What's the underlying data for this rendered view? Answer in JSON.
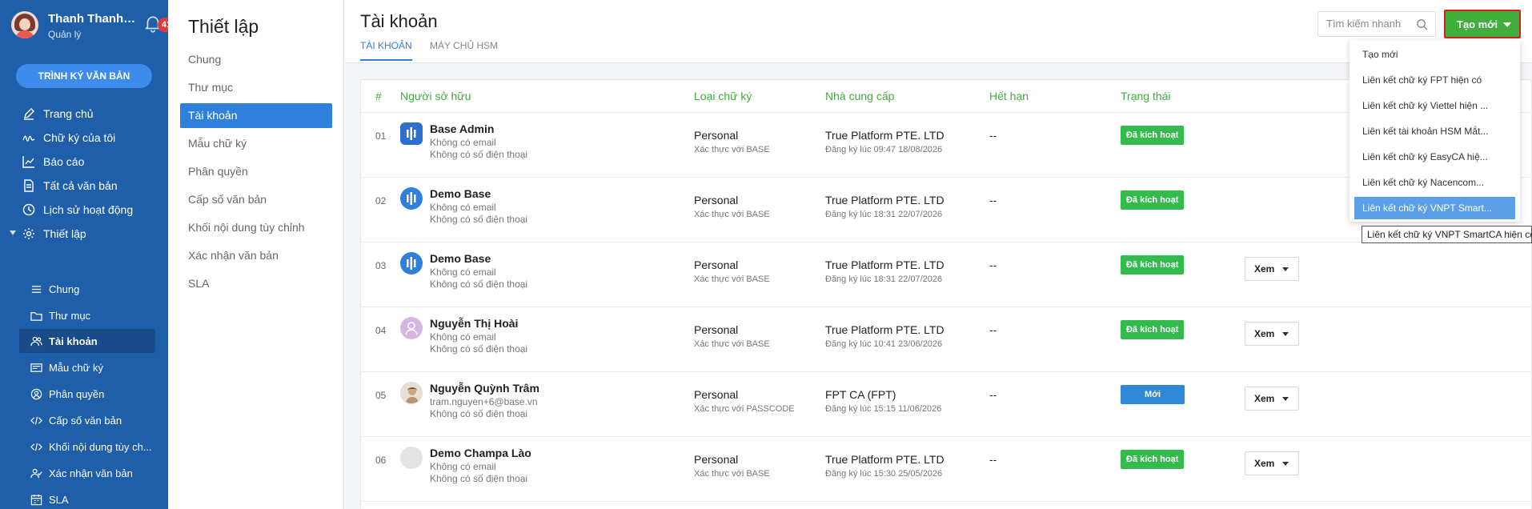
{
  "user": {
    "name": "Thanh Thanh ...",
    "role": "Quản lý",
    "notification_count": "41"
  },
  "sidebar": {
    "sign_button": "TRÌNH KÝ VĂN BẢN",
    "items": [
      {
        "label": "Trang chủ",
        "icon": "pen-icon"
      },
      {
        "label": "Chữ ký của tôi",
        "icon": "signature-icon"
      },
      {
        "label": "Báo cáo",
        "icon": "chart-icon"
      },
      {
        "label": "Tất cả văn bản",
        "icon": "document-icon"
      },
      {
        "label": "Lịch sử hoạt động",
        "icon": "clock-icon"
      },
      {
        "label": "Thiết lập",
        "icon": "gear-icon"
      }
    ],
    "sub_items": [
      {
        "label": "Chung",
        "icon": "list-icon"
      },
      {
        "label": "Thư mục",
        "icon": "folder-icon"
      },
      {
        "label": "Tài khoản",
        "icon": "users-icon"
      },
      {
        "label": "Mẫu chữ ký",
        "icon": "template-icon"
      },
      {
        "label": "Phân quyền",
        "icon": "user-circle-icon"
      },
      {
        "label": "Cấp số văn bản",
        "icon": "code-icon"
      },
      {
        "label": "Khối nội dung tùy ch...",
        "icon": "code-icon"
      },
      {
        "label": "Xác nhận văn bản",
        "icon": "user-check-icon"
      },
      {
        "label": "SLA",
        "icon": "calendar-icon"
      }
    ]
  },
  "settings": {
    "title": "Thiết lập",
    "items": [
      "Chung",
      "Thư mục",
      "Tài khoản",
      "Mẫu chữ ký",
      "Phân quyền",
      "Cấp số văn bản",
      "Khối nội dung tùy chỉnh",
      "Xác nhận văn bản",
      "SLA"
    ],
    "active": "Tài khoản"
  },
  "main": {
    "title": "Tài khoản",
    "tabs": [
      "TÀI KHOẢN",
      "MÁY CHỦ HSM"
    ],
    "search_placeholder": "Tìm kiếm nhanh",
    "create_label": "Tạo mới",
    "columns": [
      "#",
      "Người sở hữu",
      "Loại chữ ký",
      "Nhà cung cấp",
      "Hết hạn",
      "Trạng thái"
    ],
    "view_label": "Xem",
    "rows": [
      {
        "num": "01",
        "name": "Base Admin",
        "email": "Không có email",
        "phone": "Không có số điện thoại",
        "type": "Personal",
        "type_sub": "Xác thực với BASE",
        "provider": "True Platform PTE. LTD",
        "provider_sub": "Đăng ký lúc 09:47 18/08/2026",
        "expiry": "--",
        "status": "Đã kích hoạt",
        "avatar": "logo-hex"
      },
      {
        "num": "02",
        "name": "Demo Base",
        "email": "Không có email",
        "phone": "Không có số điện thoại",
        "type": "Personal",
        "type_sub": "Xác thực với BASE",
        "provider": "True Platform PTE. LTD",
        "provider_sub": "Đăng ký lúc 18:31 22/07/2026",
        "expiry": "--",
        "status": "Đã kích hoạt",
        "avatar": "logo"
      },
      {
        "num": "03",
        "name": "Demo Base",
        "email": "Không có email",
        "phone": "Không có số điện thoại",
        "type": "Personal",
        "type_sub": "Xác thực với BASE",
        "provider": "True Platform PTE. LTD",
        "provider_sub": "Đăng ký lúc 18:31 22/07/2026",
        "expiry": "--",
        "status": "Đã kích hoạt",
        "avatar": "logo"
      },
      {
        "num": "04",
        "name": "Nguyễn Thị Hoài",
        "email": "Không có email",
        "phone": "Không có số điện thoại",
        "type": "Personal",
        "type_sub": "Xác thực với BASE",
        "provider": "True Platform PTE. LTD",
        "provider_sub": "Đăng ký lúc 10:41 23/06/2026",
        "expiry": "--",
        "status": "Đã kích hoạt",
        "avatar": "person"
      },
      {
        "num": "05",
        "name": "Nguyễn Quỳnh Trâm",
        "email": "tram.nguyen+6@base.vn",
        "phone": "Không có số điện thoại",
        "type": "Personal",
        "type_sub": "Xác thực với PASSCODE",
        "provider": "FPT CA (FPT)",
        "provider_sub": "Đăng ký lúc 15:15 11/06/2026",
        "expiry": "--",
        "status": "Mới",
        "avatar": "photo"
      },
      {
        "num": "06",
        "name": "Demo Champa Lào",
        "email": "Không có email",
        "phone": "Không có số điện thoại",
        "type": "Personal",
        "type_sub": "Xác thực với BASE",
        "provider": "True Platform PTE. LTD",
        "provider_sub": "Đăng ký lúc 15:30 25/05/2026",
        "expiry": "--",
        "status": "Đã kích hoạt",
        "avatar": "plain"
      }
    ]
  },
  "dropdown": {
    "items": [
      "Tạo mới",
      "Liên kết chữ ký FPT hiện có",
      "Liên kết chữ ký Viettel hiện ...",
      "Liên kết tài khoản HSM Mắt...",
      "Liên kết chữ ký EasyCA hiệ...",
      "Liên kết chữ ký Nacencom...",
      "Liên kết chữ ký VNPT Smart..."
    ],
    "highlighted_index": 6,
    "tooltip": "Liên kết chữ ký VNPT SmartCA hiện có"
  },
  "colors": {
    "sidebar": "#1f5ea8",
    "accent": "#2f80db",
    "create": "#3fae3a",
    "active_status": "#33bb4e",
    "new_status": "#2f88d6",
    "header_text": "#3fae3a"
  }
}
